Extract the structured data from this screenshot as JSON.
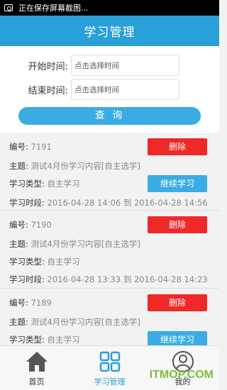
{
  "status_bar": {
    "text": "正在保存屏幕截图..."
  },
  "app_bar": {
    "title": "学习管理"
  },
  "filter": {
    "start_label": "开始时间:",
    "start_placeholder": "点击选择时间",
    "end_label": "结束时间:",
    "end_placeholder": "点击选择时间",
    "query_label": "查 询"
  },
  "records": [
    {
      "id_label": "编号:",
      "id": "7191",
      "topic_label": "主题:",
      "topic": "测试4月份学习内容[自主选学]",
      "type_label": "学习类型:",
      "type": "自主学习",
      "period_label": "学习时段:",
      "period": "2016-04-28 14:06 到 2016-04-28 14:56",
      "delete_label": "删除",
      "continue_label": "继续学习"
    },
    {
      "id_label": "编号:",
      "id": "7190",
      "topic_label": "主题:",
      "topic": "测试4月份学习内容[自主选学]",
      "type_label": "学习类型:",
      "type": "自主学习",
      "period_label": "学习时段:",
      "period": "2016-04-28 13:33 到 2016-04-28 14:23",
      "delete_label": "删除"
    },
    {
      "id_label": "编号:",
      "id": "7189",
      "topic_label": "主题:",
      "topic": "测试4月份学习内容[自主选学]",
      "type_label": "学习类型:",
      "type": "自主学习",
      "delete_label": "删除",
      "continue_label": "继续学习"
    }
  ],
  "bottom_nav": [
    {
      "label": "首页"
    },
    {
      "label": "学习管理"
    },
    {
      "label": "我的"
    }
  ],
  "watermark": "ITMOP.COM",
  "colors": {
    "primary": "#29a0d8",
    "danger": "#ef2828"
  }
}
